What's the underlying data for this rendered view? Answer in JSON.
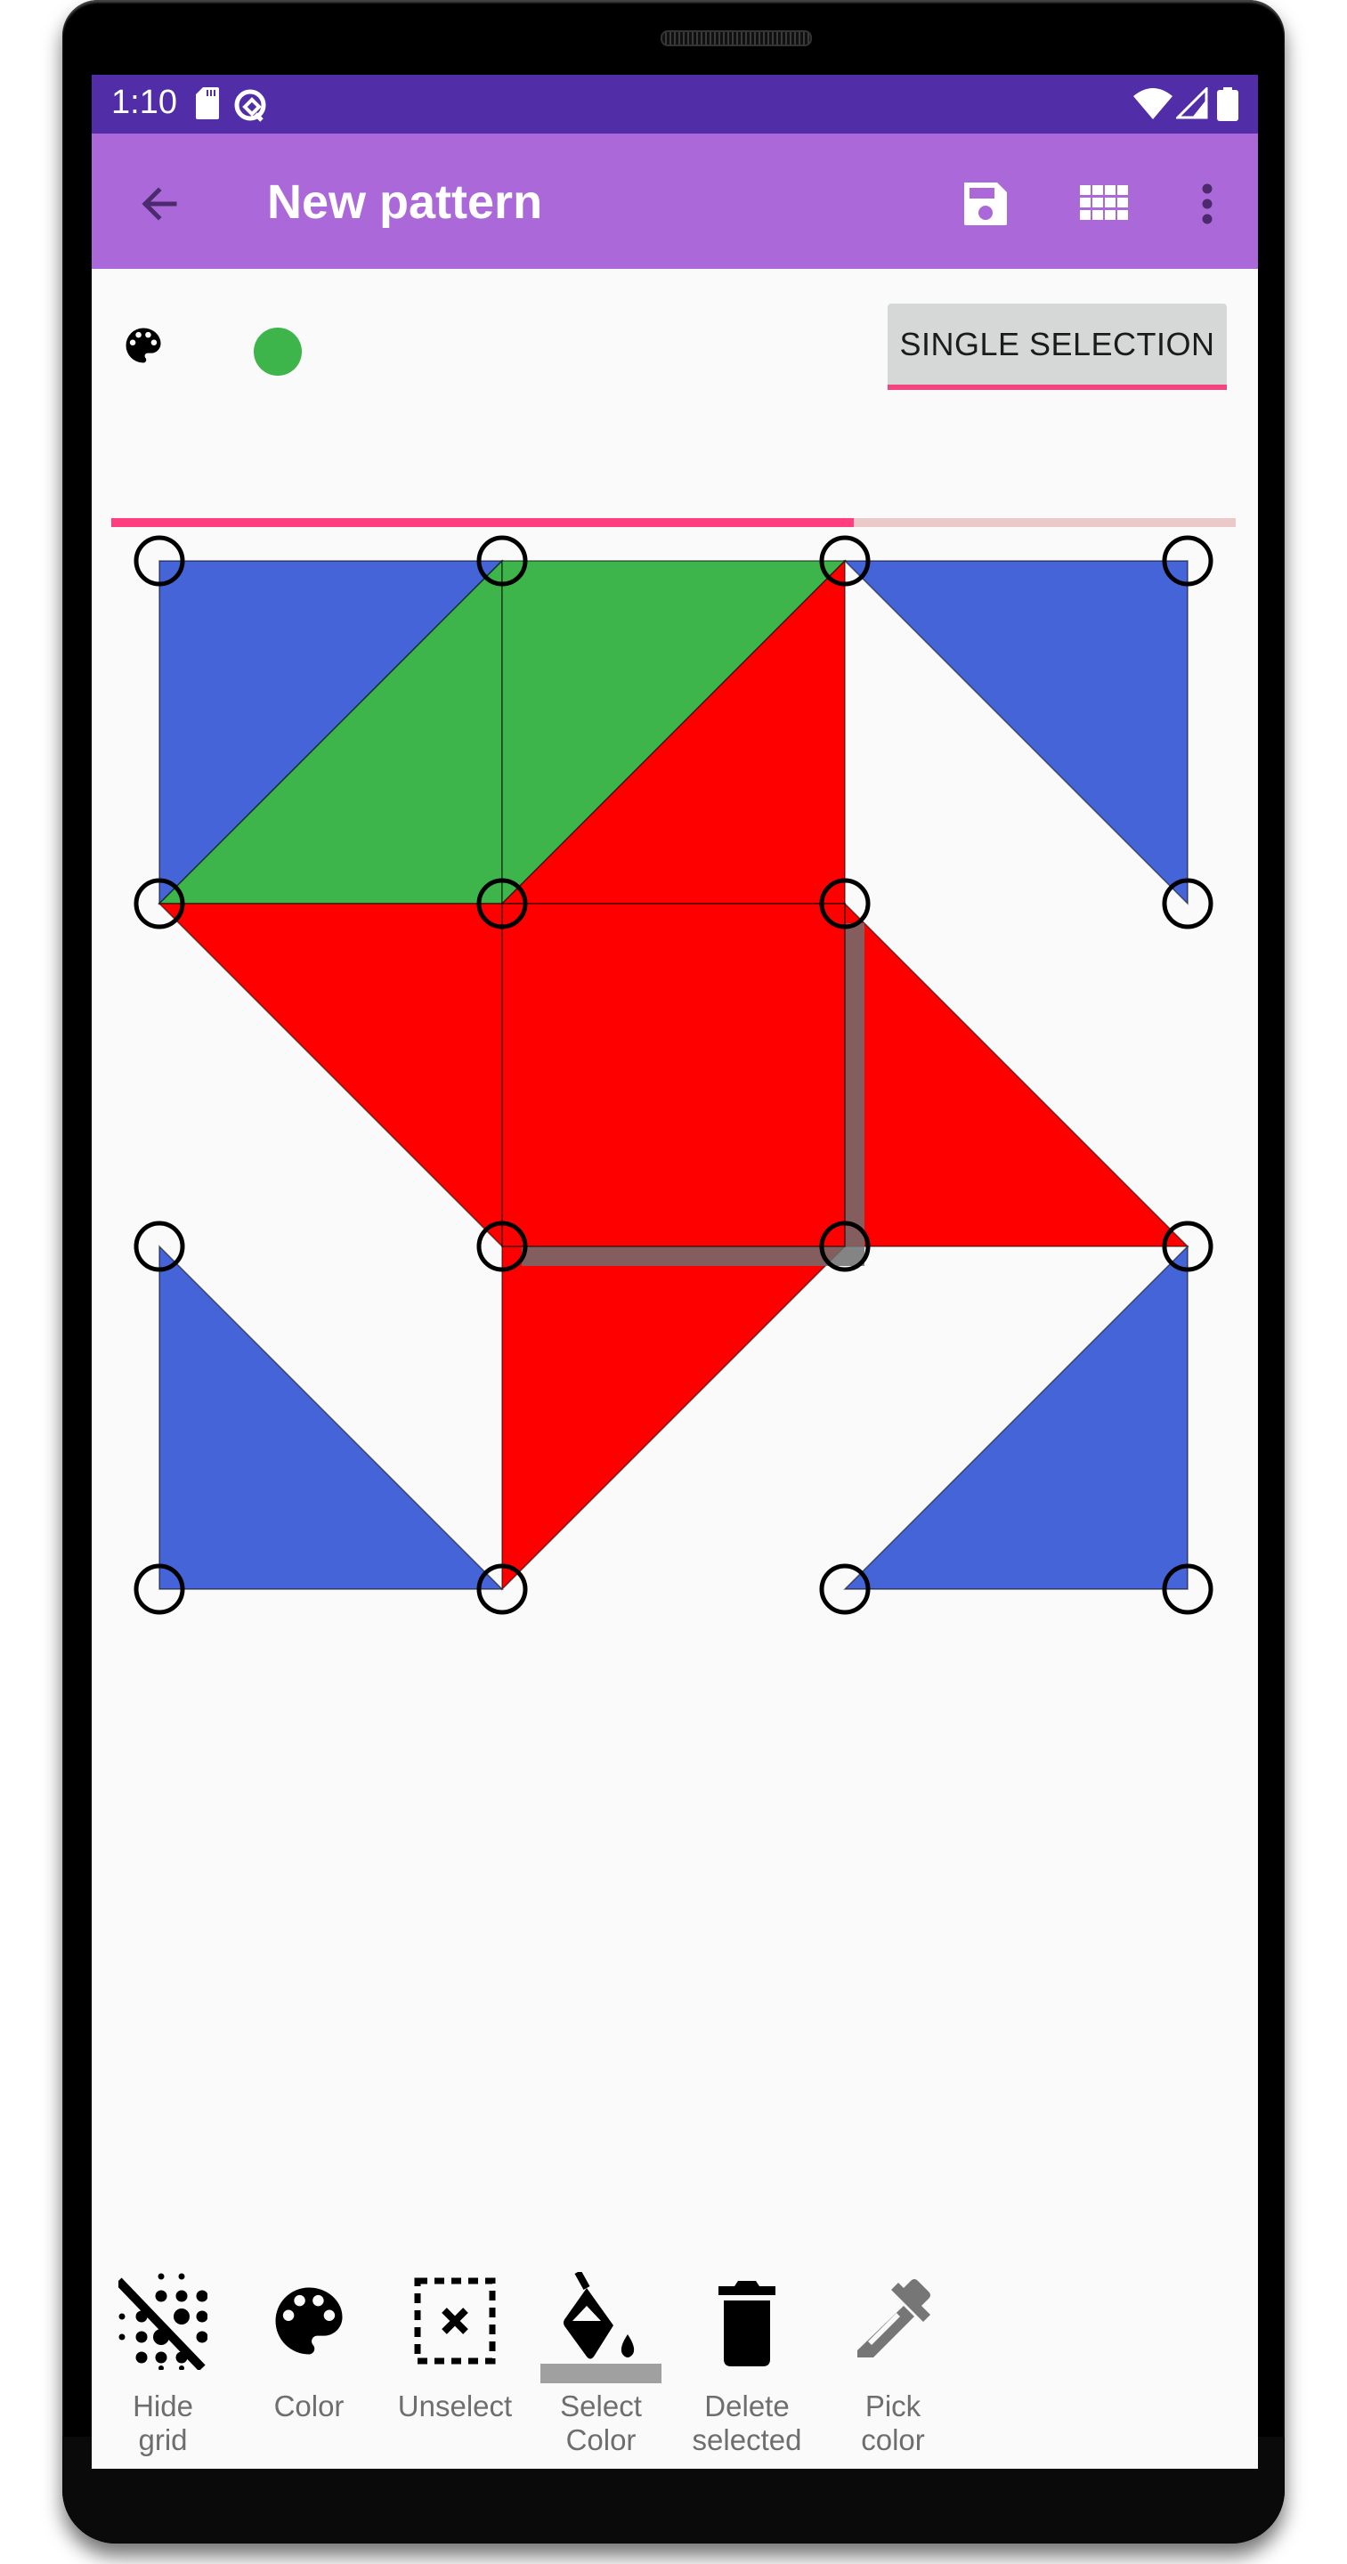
{
  "status_bar": {
    "time": "1:10",
    "left_icons": [
      "sd-card-icon",
      "data-saver-icon"
    ],
    "right_icons": [
      "wifi-icon",
      "cell-signal-icon",
      "battery-icon"
    ],
    "color": "#512da8"
  },
  "app_bar": {
    "title": "New pattern",
    "color": "#ab68d8",
    "actions": [
      {
        "name": "back",
        "icon": "arrow-back-icon"
      },
      {
        "name": "save",
        "icon": "floppy-disk-icon"
      },
      {
        "name": "grid",
        "icon": "grid-icon"
      },
      {
        "name": "more",
        "icon": "more-vertical-icon"
      }
    ]
  },
  "controls": {
    "palette_icon": "palette-icon",
    "current_color": "#3db54a",
    "selection_mode_label": "SINGLE SELECTION",
    "accent_color": "#f0457e",
    "progress": 0.66
  },
  "pattern": {
    "grid": {
      "columns": 3,
      "rows": 3
    },
    "colors": {
      "blue": "#4464d8",
      "green": "#3db54a",
      "red": "#ff0000"
    },
    "shapes": [
      {
        "cell": [
          0,
          0
        ],
        "type": "triangle",
        "corners": [
          "tl",
          "tr",
          "bl"
        ],
        "color": "blue"
      },
      {
        "cell": [
          0,
          0
        ],
        "type": "triangle",
        "corners": [
          "tr",
          "br",
          "bl"
        ],
        "color": "green"
      },
      {
        "cell": [
          1,
          0
        ],
        "type": "triangle",
        "corners": [
          "tl",
          "tr",
          "bl"
        ],
        "color": "green"
      },
      {
        "cell": [
          1,
          0
        ],
        "type": "triangle",
        "corners": [
          "tr",
          "br",
          "bl"
        ],
        "color": "red"
      },
      {
        "cell": [
          2,
          0
        ],
        "type": "triangle",
        "corners": [
          "tl",
          "tr",
          "br"
        ],
        "color": "blue"
      },
      {
        "cell": [
          0,
          1
        ],
        "type": "triangle",
        "corners": [
          "tl",
          "tr",
          "br"
        ],
        "color": "red"
      },
      {
        "cell": [
          2,
          1
        ],
        "type": "triangle",
        "corners": [
          "tl",
          "bl",
          "br"
        ],
        "color": "red"
      },
      {
        "cell": [
          0,
          2
        ],
        "type": "triangle",
        "corners": [
          "tl",
          "bl",
          "br"
        ],
        "color": "blue"
      },
      {
        "cell": [
          1,
          2
        ],
        "type": "triangle",
        "corners": [
          "tl",
          "tr",
          "bl"
        ],
        "color": "red"
      },
      {
        "cell": [
          2,
          2
        ],
        "type": "triangle",
        "corners": [
          "tr",
          "br",
          "bl"
        ],
        "color": "blue"
      },
      {
        "cell": [
          1,
          1
        ],
        "type": "square",
        "color": "red",
        "selected": true
      }
    ]
  },
  "toolbar": {
    "items": [
      {
        "label": "Hide\ngrid",
        "icon": "hide-grid-icon",
        "active": false
      },
      {
        "label": "Color",
        "icon": "palette-icon",
        "active": false
      },
      {
        "label": "Unselect",
        "icon": "deselect-icon",
        "active": false
      },
      {
        "label": "Select\nColor",
        "icon": "paint-bucket-icon",
        "active": true
      },
      {
        "label": "Delete\nselected",
        "icon": "trash-icon",
        "active": false
      },
      {
        "label": "Pick\ncolor",
        "icon": "eyedropper-icon",
        "active": false
      }
    ]
  }
}
